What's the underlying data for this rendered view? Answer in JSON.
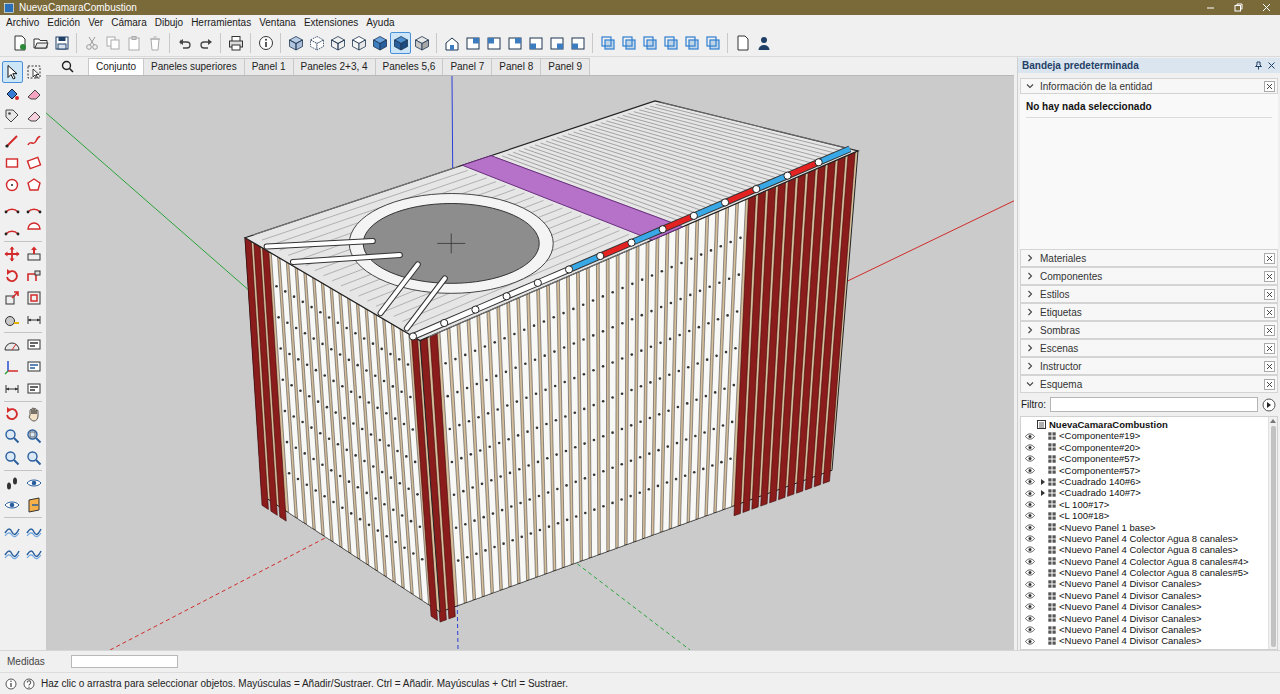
{
  "window": {
    "title": "NuevaCamaraCombustion"
  },
  "menu": [
    "Archivo",
    "Edición",
    "Ver",
    "Cámara",
    "Dibujo",
    "Herramientas",
    "Ventana",
    "Extensiones",
    "Ayuda"
  ],
  "main_toolbar": [
    {
      "selected": false
    },
    {
      "selected": false
    },
    {
      "selected": false
    },
    {
      "selected": false
    },
    {
      "selected": false
    },
    {
      "selected": false
    },
    {
      "selected": false
    },
    {
      "selected": false
    },
    {
      "selected": false
    },
    {
      "selected": false
    },
    {
      "selected": false
    },
    {
      "selected": false
    },
    {
      "selected": false
    },
    {
      "selected": false
    },
    {
      "selected": false
    },
    {
      "selected": false
    },
    {
      "selected": true
    },
    {
      "selected": false
    },
    {
      "selected": false
    },
    {
      "selected": false
    },
    {
      "selected": false
    },
    {
      "selected": false
    },
    {
      "selected": false
    },
    {
      "selected": false
    },
    {
      "selected": false
    },
    {
      "selected": false
    },
    {
      "selected": false
    },
    {
      "selected": false
    },
    {
      "selected": false
    },
    {
      "selected": false
    },
    {
      "selected": false
    },
    {
      "selected": false
    },
    {
      "selected": false
    }
  ],
  "left_toolbar": [
    {
      "selected": true
    },
    {
      "selected": false
    },
    {
      "selected": false
    },
    {
      "selected": false
    },
    {
      "selected": false
    },
    {
      "selected": false
    },
    {
      "selected": false
    },
    {
      "selected": false
    },
    {
      "selected": false
    },
    {
      "selected": false
    },
    {
      "selected": false
    },
    {
      "selected": false
    },
    {
      "selected": false
    },
    {
      "selected": false
    },
    {
      "selected": false
    },
    {
      "selected": false
    },
    {
      "selected": false
    },
    {
      "selected": false
    },
    {
      "selected": false
    },
    {
      "selected": false
    },
    {
      "selected": false
    },
    {
      "selected": false
    },
    {
      "selected": false
    },
    {
      "selected": false
    },
    {
      "selected": false
    },
    {
      "selected": false
    },
    {
      "selected": false
    },
    {
      "selected": false
    },
    {
      "selected": false
    },
    {
      "selected": false
    },
    {
      "selected": false
    },
    {
      "selected": false
    },
    {
      "selected": false
    },
    {
      "selected": false
    },
    {
      "selected": false
    },
    {
      "selected": false
    },
    {
      "selected": false
    },
    {
      "selected": false
    },
    {
      "selected": false
    },
    {
      "selected": false
    },
    {
      "selected": false
    },
    {
      "selected": false
    },
    {
      "selected": false
    },
    {
      "selected": false
    }
  ],
  "scene_tabs": [
    {
      "label": "Conjunto",
      "selected": true
    },
    {
      "label": "Paneles superiores",
      "selected": false
    },
    {
      "label": "Panel 1",
      "selected": false
    },
    {
      "label": "Paneles 2+3, 4",
      "selected": false
    },
    {
      "label": "Paneles 5,6",
      "selected": false
    },
    {
      "label": "Panel 7",
      "selected": false
    },
    {
      "label": "Panel 8",
      "selected": false
    },
    {
      "label": "Panel 9",
      "selected": false
    }
  ],
  "tray": {
    "title": "Bandeja predeterminada",
    "panels": [
      {
        "label": "Información de la entidad",
        "expanded": true
      },
      {
        "label": "Materiales",
        "expanded": false
      },
      {
        "label": "Componentes",
        "expanded": false
      },
      {
        "label": "Estilos",
        "expanded": false
      },
      {
        "label": "Etiquetas",
        "expanded": false
      },
      {
        "label": "Sombras",
        "expanded": false
      },
      {
        "label": "Escenas",
        "expanded": false
      },
      {
        "label": "Instructor",
        "expanded": false
      },
      {
        "label": "Esquema",
        "expanded": true
      }
    ]
  },
  "entity_info": {
    "message": "No hay nada seleccionado"
  },
  "outliner": {
    "filter_label": "Filtro:",
    "filter_value": "",
    "root": "NuevaCamaraCombustion",
    "items": [
      {
        "name": "<Componente#19>",
        "visible": true,
        "expandable": false,
        "expanded": false
      },
      {
        "name": "<Componente#20>",
        "visible": true,
        "expandable": false,
        "expanded": false
      },
      {
        "name": "<Componente#57>",
        "visible": true,
        "expandable": false,
        "expanded": false
      },
      {
        "name": "<Componente#57>",
        "visible": true,
        "expandable": false,
        "expanded": false
      },
      {
        "name": "<Cuadrado 140#6>",
        "visible": true,
        "expandable": true,
        "expanded": false
      },
      {
        "name": "<Cuadrado 140#7>",
        "visible": true,
        "expandable": true,
        "expanded": false
      },
      {
        "name": "<L 100#17>",
        "visible": true,
        "expandable": false,
        "expanded": false
      },
      {
        "name": "<L 100#18>",
        "visible": true,
        "expandable": false,
        "expanded": false
      },
      {
        "name": "<Nuevo Panel 1 base>",
        "visible": true,
        "expandable": false,
        "expanded": false
      },
      {
        "name": "<Nuevo Panel 4 Colector Agua 8 canales>",
        "visible": true,
        "expandable": false,
        "expanded": false
      },
      {
        "name": "<Nuevo Panel 4 Colector Agua 8 canales>",
        "visible": true,
        "expandable": false,
        "expanded": false
      },
      {
        "name": "<Nuevo Panel 4 Colector Agua 8 canales#4>",
        "visible": true,
        "expandable": false,
        "expanded": false
      },
      {
        "name": "<Nuevo Panel 4 Colector Agua 8 canales#5>",
        "visible": true,
        "expandable": false,
        "expanded": false
      },
      {
        "name": "<Nuevo Panel 4 Divisor Canales>",
        "visible": true,
        "expandable": false,
        "expanded": false
      },
      {
        "name": "<Nuevo Panel 4 Divisor Canales>",
        "visible": true,
        "expandable": false,
        "expanded": false
      },
      {
        "name": "<Nuevo Panel 4 Divisor Canales>",
        "visible": true,
        "expandable": false,
        "expanded": false
      },
      {
        "name": "<Nuevo Panel 4 Divisor Canales>",
        "visible": true,
        "expandable": false,
        "expanded": false
      },
      {
        "name": "<Nuevo Panel 4 Divisor Canales>",
        "visible": true,
        "expandable": false,
        "expanded": false
      },
      {
        "name": "<Nuevo Panel 4 Divisor Canales>",
        "visible": true,
        "expandable": false,
        "expanded": false
      }
    ]
  },
  "measurements": {
    "label": "Medidas",
    "value": ""
  },
  "status_bar": {
    "text": "Haz clic o arrastra para seleccionar objetos. Mayúsculas = Añadir/Sustraer. Ctrl = Añadir. Mayúsculas + Ctrl = Sustraer."
  }
}
